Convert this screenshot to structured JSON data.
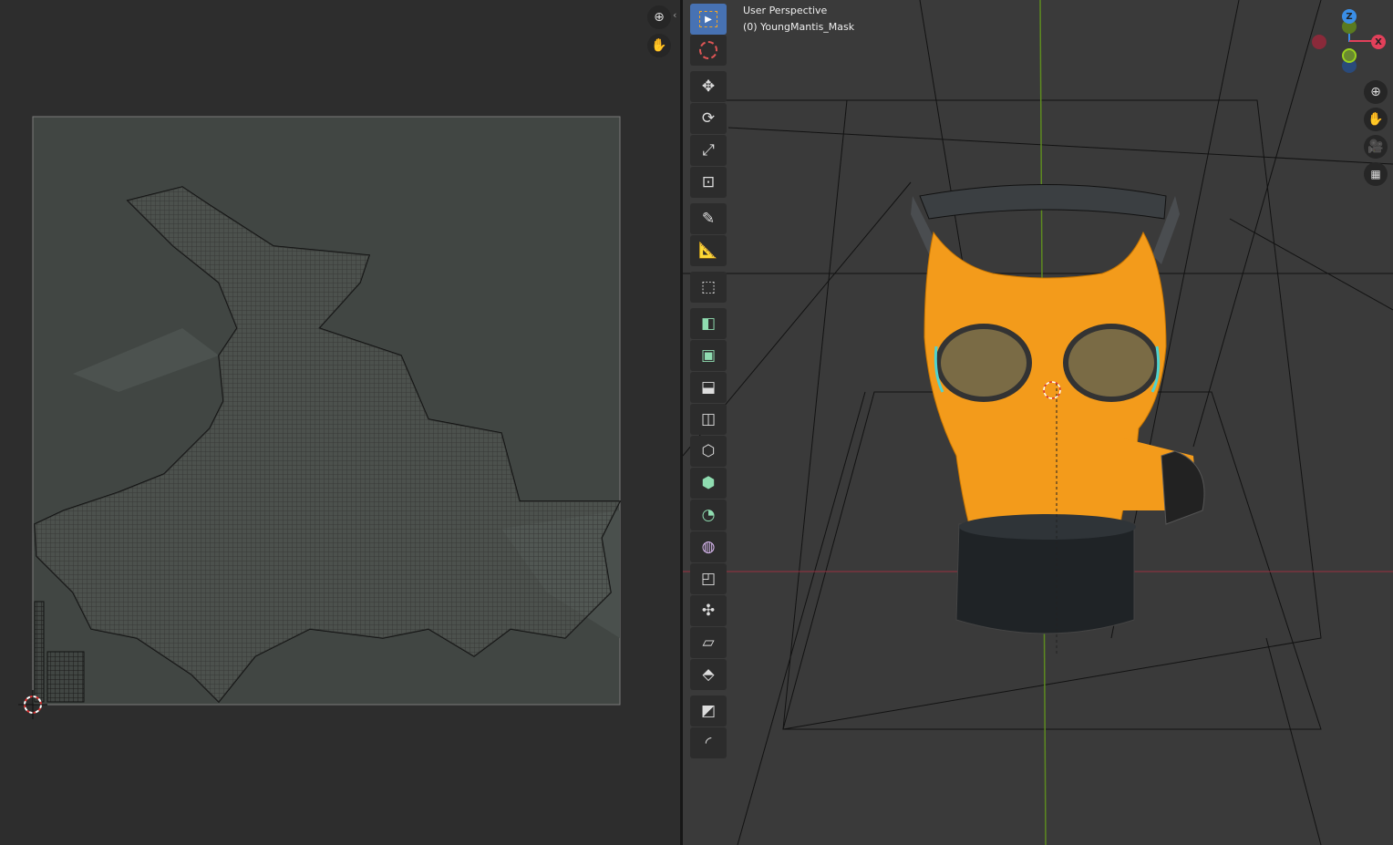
{
  "viewport": {
    "view_name": "User Perspective",
    "object_label": "(0) YoungMantis_Mask",
    "gizmo": {
      "x_label": "X",
      "y_label": "Y",
      "z_label": "Z"
    },
    "colors": {
      "x": "#e2405a",
      "y": "#8bc41e",
      "z": "#3a8ee6",
      "selection": "#f39b1b",
      "active_tool": "#4772b3"
    }
  },
  "uv_editor": {
    "nav": [
      "zoom-icon",
      "hand-pan-icon"
    ]
  },
  "toolbar": {
    "tools": [
      "select-box",
      "cursor",
      "move",
      "rotate",
      "scale",
      "transform",
      "annotate",
      "measure",
      "add-cube",
      "extrude-region",
      "inset-faces",
      "bevel",
      "loop-cut",
      "knife",
      "poly-build",
      "spin",
      "smooth",
      "edge-slide",
      "shrink-fatten",
      "shear",
      "rip-region",
      "to-sphere",
      "rip-edge"
    ]
  }
}
